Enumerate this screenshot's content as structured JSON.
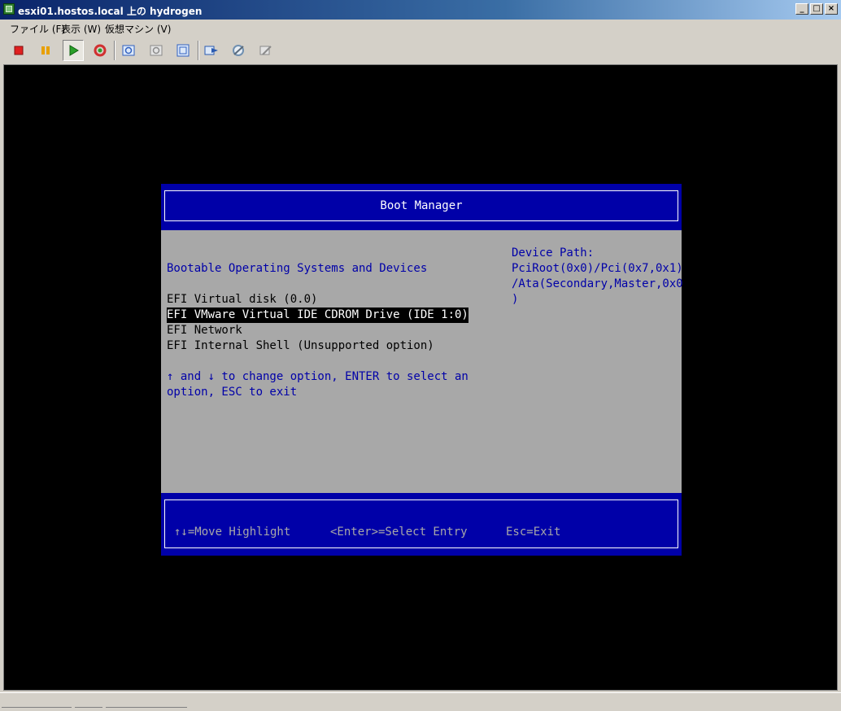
{
  "window": {
    "title": "esxi01.hostos.local 上の hydrogen",
    "controls": {
      "minimize": "_",
      "maximize": "□",
      "close": "×"
    }
  },
  "menu": {
    "items": [
      "ファイル (F)",
      "表示 (W)",
      "仮想マシン (V)"
    ]
  },
  "toolbar": {
    "buttons": [
      {
        "name": "power-off-icon",
        "color": "#e02020"
      },
      {
        "name": "suspend-icon",
        "color": "#e8a000"
      },
      {
        "name": "power-on-icon",
        "color": "#2aa02a"
      },
      {
        "name": "reset-icon",
        "color": "#d03030"
      },
      {
        "name": "snapshot-icon",
        "color": "#3060c0"
      },
      {
        "name": "revert-snapshot-icon",
        "color": "#8a8a8a"
      },
      {
        "name": "snapshot-manager-icon",
        "color": "#3060c0"
      },
      {
        "name": "connect-devices-icon",
        "color": "#2a5ab0"
      },
      {
        "name": "settings-icon",
        "color": "#7090b0"
      },
      {
        "name": "console-options-icon",
        "color": "#8a8a8a"
      }
    ]
  },
  "boot_manager": {
    "title": "Boot Manager",
    "section_heading": "Bootable Operating Systems and Devices",
    "options": [
      "EFI Virtual disk (0.0)",
      "EFI VMware Virtual IDE CDROM Drive (IDE 1:0)",
      "EFI Network",
      "EFI Internal Shell (Unsupported option)"
    ],
    "selected_index": 1,
    "help_line1": "↑ and ↓ to change option, ENTER to select an",
    "help_line2": "option, ESC to exit",
    "device_path_label": "Device Path:",
    "device_path_line1": "PciRoot(0x0)/Pci(0x7,0x1)",
    "device_path_line2": "/Ata(Secondary,Master,0x0",
    "device_path_line3": ")",
    "footer": {
      "move": "↑↓=Move Highlight",
      "select": "<Enter>=Select Entry",
      "exit": "Esc=Exit"
    },
    "colors": {
      "frame": "#0000a8",
      "body": "#a8a8a8",
      "selected_bg": "#000000"
    }
  }
}
